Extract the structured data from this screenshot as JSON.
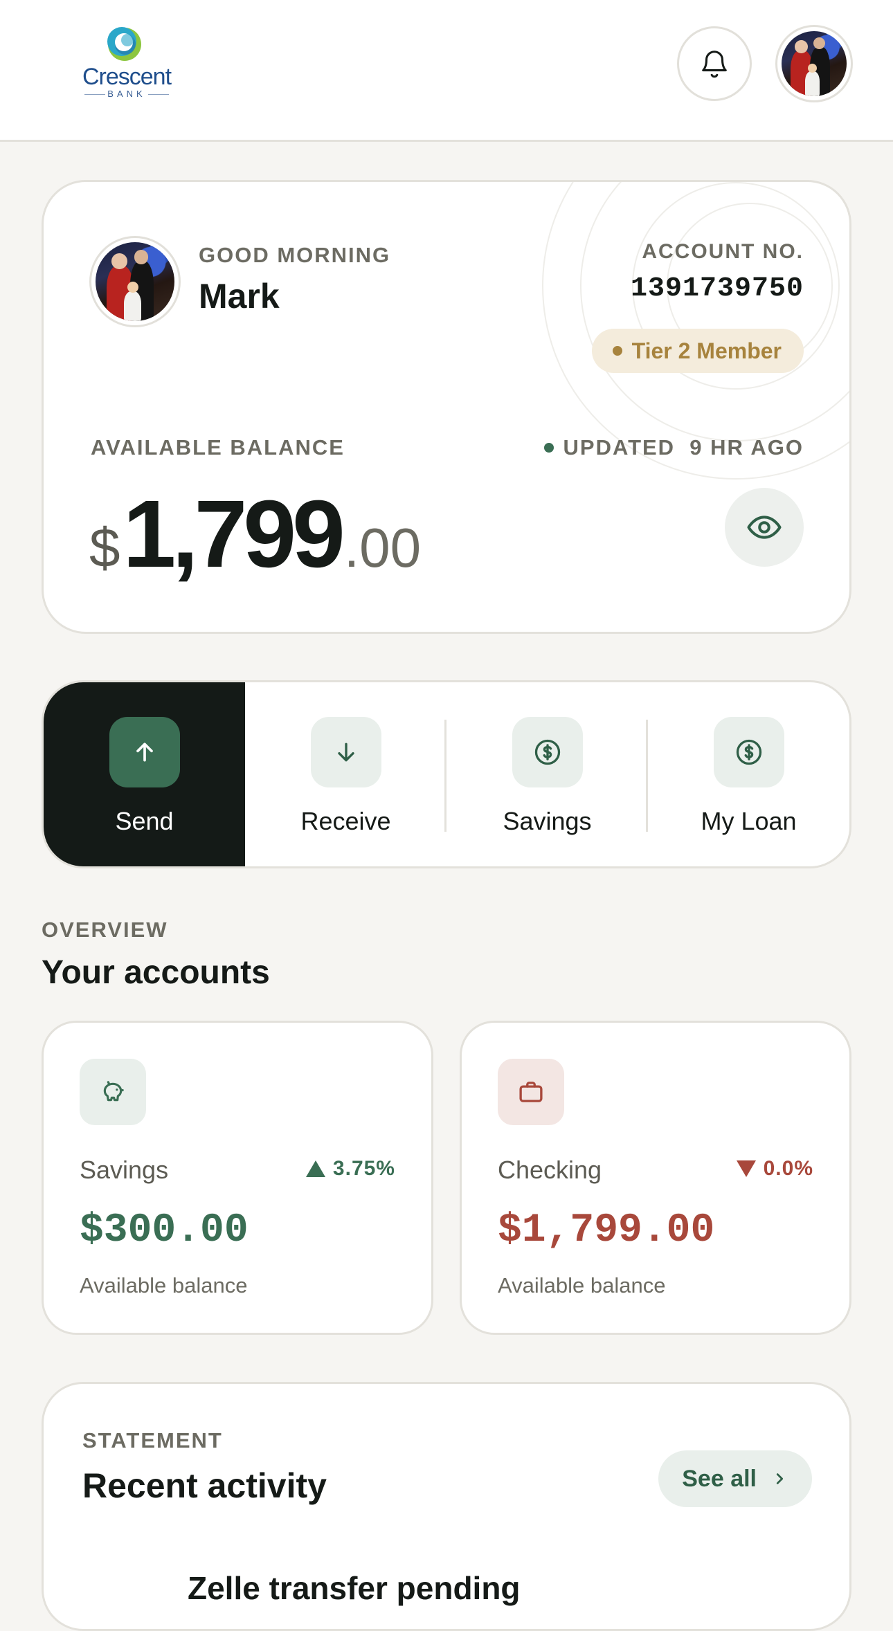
{
  "header": {
    "logo": {
      "name": "Crescent",
      "sub": "BANK"
    }
  },
  "balance_card": {
    "greeting": "GOOD MORNING",
    "user_name": "Mark",
    "account_label": "ACCOUNT NO.",
    "account_number": "1391739750",
    "tier": "Tier 2 Member",
    "available_label": "AVAILABLE BALANCE",
    "updated_text": "UPDATED  9 HR AGO",
    "balance": {
      "currency": "$",
      "main": "1,799",
      "cents": ".00"
    }
  },
  "actions": [
    {
      "label": "Send",
      "icon": "arrow-up-icon",
      "active": true
    },
    {
      "label": "Receive",
      "icon": "arrow-down-icon",
      "active": false
    },
    {
      "label": "Savings",
      "icon": "dollar-circle-icon",
      "active": false
    },
    {
      "label": "My Loan",
      "icon": "dollar-circle-icon",
      "active": false
    }
  ],
  "overview": {
    "label": "OVERVIEW",
    "title": "Your accounts",
    "accounts": [
      {
        "name": "Savings",
        "change": "3.75%",
        "direction": "up",
        "balance": "$300.00",
        "sub": "Available balance",
        "icon": "piggy-bank-icon",
        "color": "#3a6e54"
      },
      {
        "name": "Checking",
        "change": "0.0%",
        "direction": "down",
        "balance": "$1,799.00",
        "sub": "Available balance",
        "icon": "briefcase-icon",
        "color": "#a8483b"
      }
    ]
  },
  "statement": {
    "label": "STATEMENT",
    "title": "Recent activity",
    "see_all": "See all",
    "peek_text": "Zelle transfer pending"
  },
  "colors": {
    "accent": "#3a6e54",
    "dark": "#141a17",
    "negative": "#a8483b",
    "tier": "#a7833d"
  }
}
